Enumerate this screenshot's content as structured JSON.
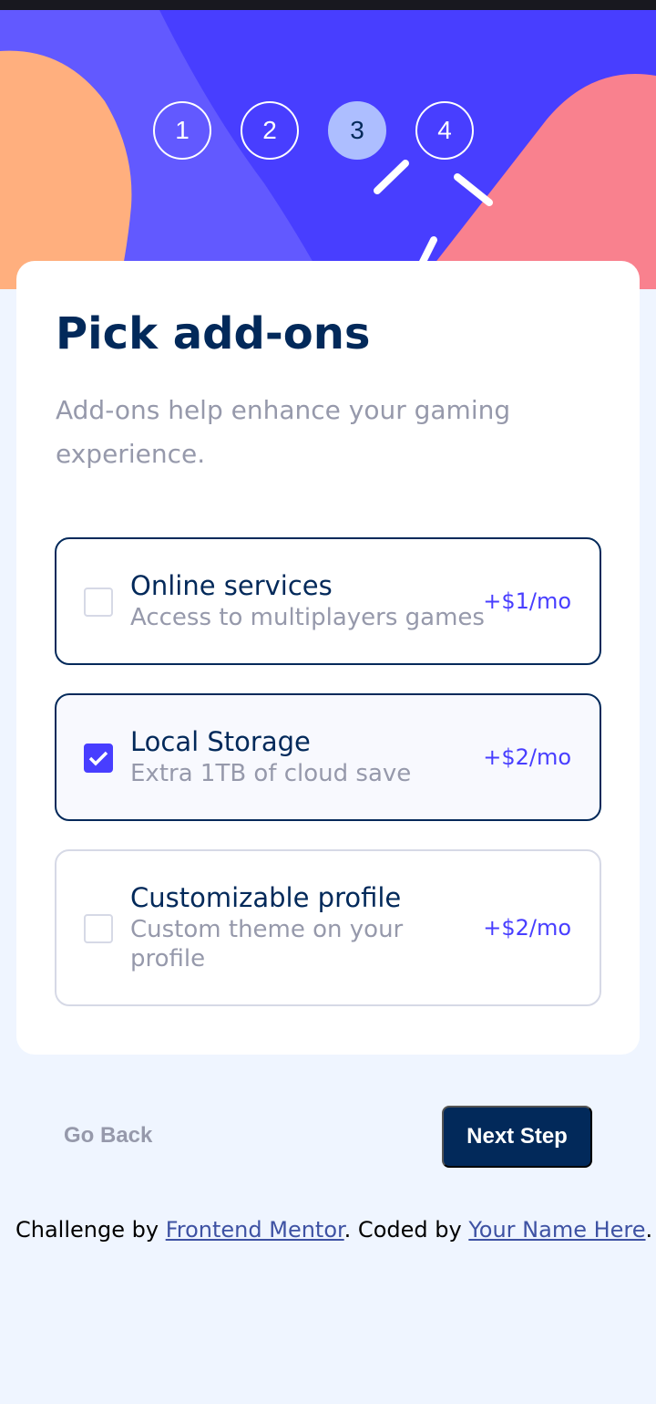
{
  "steps": [
    {
      "number": "1",
      "active": false
    },
    {
      "number": "2",
      "active": false
    },
    {
      "number": "3",
      "active": true
    },
    {
      "number": "4",
      "active": false
    }
  ],
  "form": {
    "title": "Pick add-ons",
    "subtitle": "Add-ons help enhance your gaming experience."
  },
  "addons": [
    {
      "name": "Online services",
      "description": "Access to multiplayers games",
      "price": "+$1/mo",
      "checked": false
    },
    {
      "name": "Local Storage",
      "description": "Extra 1TB of cloud save",
      "price": "+$2/mo",
      "checked": true
    },
    {
      "name": "Customizable profile",
      "description": "Custom theme on your profile",
      "price": "+$2/mo",
      "checked": false
    }
  ],
  "nav": {
    "back_label": "Go Back",
    "next_label": "Next Step"
  },
  "attribution": {
    "prefix": "Challenge by ",
    "link1": "Frontend Mentor",
    "middle": ". Coded by ",
    "link2": "Your Name Here",
    "suffix": "."
  },
  "colors": {
    "primary": "#02295a",
    "accent": "#483eff",
    "active_step": "#adbeff",
    "background": "#eff5ff",
    "muted_text": "#9699ab"
  }
}
